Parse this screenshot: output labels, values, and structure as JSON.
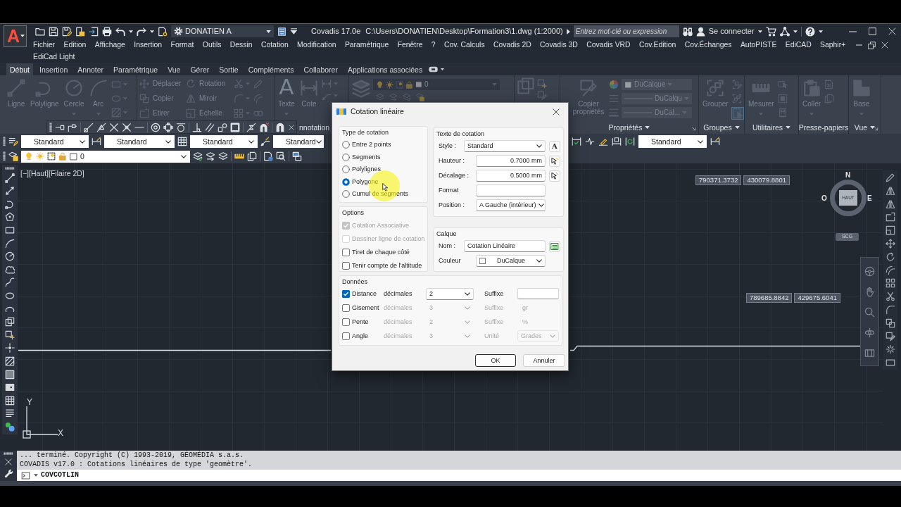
{
  "title_bar": {
    "app_logo": "A",
    "workspace": "DONATIEN A",
    "app_name": "Covadis 17.0e",
    "file_path": "C:\\Users\\DONATIEN\\Desktop\\Formation3\\1.dwg (1:2000)",
    "search": {
      "placeholder": "Entrez mot-clé ou expression"
    },
    "sign_in": "Se connecter"
  },
  "menu_bar": {
    "rows": [
      [
        "Fichier",
        "Edition",
        "Affichage",
        "Insertion",
        "Format",
        "Outils",
        "Dessin",
        "Cotation",
        "Modification",
        "Paramétrique",
        "Fenêtre",
        "?",
        "Cov. Calculs",
        "Covadis 2D",
        "Covadis 3D",
        "Covadis VRD",
        "Cov.Edition",
        "Cov.Échanges",
        "AutoPISTE",
        "EdiCAD",
        "Saphir+"
      ],
      [
        "EdiCad Light"
      ]
    ]
  },
  "ribbon": {
    "disabled": true,
    "tabs": [
      {
        "label": "Début",
        "selected": true
      },
      {
        "label": "Insertion",
        "selected": false
      },
      {
        "label": "Annoter",
        "selected": false
      },
      {
        "label": "Paramétrique",
        "selected": false
      },
      {
        "label": "Vue",
        "selected": false
      },
      {
        "label": "Gérer",
        "selected": false
      },
      {
        "label": "Sortie",
        "selected": false
      },
      {
        "label": "Compléments",
        "selected": false
      },
      {
        "label": "Collaborer",
        "selected": false
      },
      {
        "label": "Applications associées",
        "selected": false
      }
    ],
    "panels": [
      {
        "kind": "draw",
        "large_tools": [
          {
            "label": "Ligne",
            "dropdown": false
          },
          {
            "label": "Polyligne",
            "dropdown": false
          },
          {
            "label": "Cercle",
            "dropdown": true
          },
          {
            "label": "Arc",
            "dropdown": true
          }
        ]
      },
      {
        "kind": "modify",
        "small_tools": [
          {
            "label": "Déplacer"
          },
          {
            "label": "Rotation"
          },
          {
            "label": "Copier"
          },
          {
            "label": "Miroir"
          },
          {
            "label": "Etirer"
          },
          {
            "label": "Echelle"
          }
        ]
      },
      {
        "kind": "annotation",
        "title": "nnotation",
        "dropdown": false,
        "large_tools": [
          {
            "label": "Texte",
            "glyph": "A",
            "dropdown": true
          },
          {
            "label": "Cote",
            "dropdown": false
          }
        ]
      },
      {
        "kind": "layers",
        "layer": "0"
      },
      {
        "kind": "block"
      },
      {
        "kind": "properties",
        "title": "Propriétés",
        "dropdown": true,
        "large_tools": [
          {
            "label": "Copier propriétés",
            "dropdown": false
          }
        ],
        "combos": [
          "DuCalque",
          "DuCalqu",
          "DuCal..."
        ]
      },
      {
        "kind": "groups",
        "title": "Groupes",
        "dropdown": true,
        "selection_active": true,
        "large_tools": [
          {
            "label": "Grouper",
            "dropdown": false
          }
        ]
      },
      {
        "kind": "utilities",
        "title": "Utilitaires",
        "dropdown": true,
        "large_tools": [
          {
            "label": "Mesurer",
            "dropdown": true
          }
        ]
      },
      {
        "kind": "clipboard",
        "title": "Presse-papiers",
        "dropdown": false,
        "large_tools": [
          {
            "label": "Coller",
            "dropdown": true
          }
        ]
      },
      {
        "kind": "view",
        "title": "Vue",
        "dropdown": true,
        "large_tools": [
          {
            "label": "Base",
            "dropdown": true
          }
        ]
      }
    ]
  },
  "style_toolbar": {
    "styles": [
      "Standard",
      "Standard",
      "Standard",
      "Standard"
    ],
    "dimension_style": "Standard"
  },
  "layer_toolbar": {
    "layer": "0"
  },
  "drawing": {
    "viewport_label": "[−][Haut][Filaire 2D]",
    "coordinate_tags": [
      [
        "790371.3732",
        "430079.8801"
      ],
      [
        "789685.8842",
        "429675.6041"
      ]
    ],
    "viewcube": {
      "north": "N",
      "west": "O",
      "east": "E",
      "face": "HAUT",
      "ucs": "SCG"
    },
    "ucs_icon": {
      "x": "X",
      "y": "Y"
    }
  },
  "command_line": {
    "history": [
      "... terminé. Copyright (C) 1993-2019, GÉOMÉDIA s.a.s.",
      "COVADIS v17.0 : Cotations linéaires de type 'geomètre'."
    ],
    "input": "COVCOTLIN"
  },
  "dialog": {
    "title": "Cotation linéaire",
    "type_group": {
      "title": "Type de cotation",
      "options": [
        {
          "label": "Entre 2 points",
          "selected": false
        },
        {
          "label": "Segments",
          "selected": false
        },
        {
          "label": "Polylignes",
          "selected": false
        },
        {
          "label": "Polygone",
          "selected": true
        },
        {
          "label": "Cumul de segments",
          "selected": false
        }
      ]
    },
    "options_group": {
      "title": "Options",
      "items": [
        {
          "label": "Cotation Associative",
          "checked": true,
          "disabled": true
        },
        {
          "label": "Dessiner ligne de cotation",
          "checked": false,
          "disabled": true
        },
        {
          "label": "Tiret de chaque côté",
          "checked": false,
          "disabled": false
        },
        {
          "label": "Tenir compte de l'altitude",
          "checked": false,
          "disabled": false
        }
      ]
    },
    "text_group": {
      "title": "Texte de cotation",
      "fields": [
        {
          "label": "Style :",
          "kind": "select",
          "value": "Standard",
          "button": {
            "kind": "glyph",
            "glyph": "A"
          }
        },
        {
          "label": "Hauteur :",
          "kind": "number",
          "value": "0.7000 mm",
          "button": {
            "kind": "pick"
          }
        },
        {
          "label": "Décalage :",
          "kind": "number",
          "value": "0.5000 mm",
          "button": {
            "kind": "pick"
          }
        },
        {
          "label": "Format",
          "kind": "text"
        },
        {
          "label": "Position :",
          "kind": "select",
          "value": "A Gauche (intérieur)"
        }
      ]
    },
    "layer_group": {
      "title": "Calque",
      "fields": [
        {
          "label": "Nom :",
          "kind": "text",
          "value": "Cotation Linéaire",
          "button": {
            "kind": "layers"
          }
        },
        {
          "label": "Couleur",
          "kind": "color_select",
          "value": "DuCalque"
        }
      ]
    },
    "data_group": {
      "title": "Données",
      "rows": [
        {
          "label": "Distance",
          "checked": true,
          "decimals_label": "décimales",
          "decimals": "2",
          "extra_label": "Suffixe",
          "extra": {
            "kind": "input"
          }
        },
        {
          "label": "Gisement",
          "checked": false,
          "decimals_label": "décimales",
          "decimals": "3",
          "extra_label": "Suffixe",
          "extra": {
            "kind": "text",
            "value": "gr"
          }
        },
        {
          "label": "Pente",
          "checked": false,
          "decimals_label": "décimales",
          "decimals": "2",
          "extra_label": "Suffixe",
          "extra": {
            "kind": "text",
            "value": "%"
          }
        },
        {
          "label": "Angle",
          "checked": false,
          "decimals_label": "décimales",
          "decimals": "3",
          "extra_label": "Unité",
          "extra": {
            "kind": "select",
            "value": "Grades"
          }
        }
      ]
    },
    "buttons": [
      {
        "label": "OK",
        "default": true
      },
      {
        "label": "Annuler",
        "default": false
      }
    ]
  }
}
